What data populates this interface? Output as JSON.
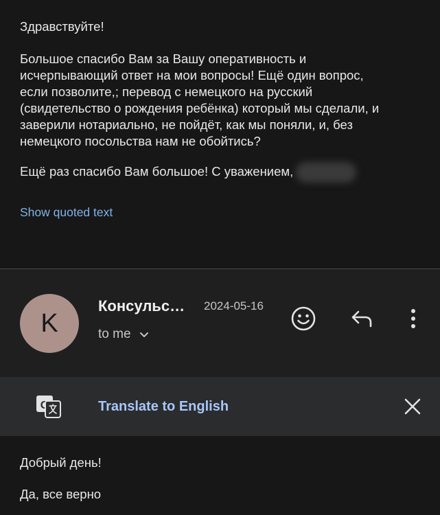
{
  "previous_message": {
    "greeting": "Здравствуйте!",
    "paragraph_lines": [
      "Большое спасибо Вам за Вашу оперативность и",
      "исчерпывающий ответ на мои вопросы! Ещё один вопрос,",
      "если позволите,; перевод с немецкого на русский",
      "(свидетельство о рождения ребёнка) который мы сделали, и",
      "заверили нотариально,  не пойдёт, как мы поняли,  и, без",
      "немецкого посольства нам не обойтись?"
    ],
    "closing": "Ещё раз спасибо Вам большое! С уважением,",
    "show_quoted_label": "Show quoted text"
  },
  "message_header": {
    "avatar_letter": "K",
    "sender": "Консульс…",
    "date": "2024-05-16",
    "recipient_label": "to me",
    "icons": {
      "emoji": "emoji-reaction-icon",
      "reply": "reply-icon",
      "more": "more-vertical-icon"
    }
  },
  "translate_bar": {
    "label": "Translate to English",
    "icon": "translate-icon",
    "close_icon": "close-icon"
  },
  "reply_message": {
    "lines": [
      "Добрый день!",
      "Да, все верно"
    ]
  },
  "colors": {
    "background": "#171717",
    "header_bg": "#1f1f1f",
    "translate_bar_bg": "#2b2c2e",
    "link": "#7fb3e8",
    "translate_link": "#a8c7fa",
    "avatar": "#ad928b"
  }
}
